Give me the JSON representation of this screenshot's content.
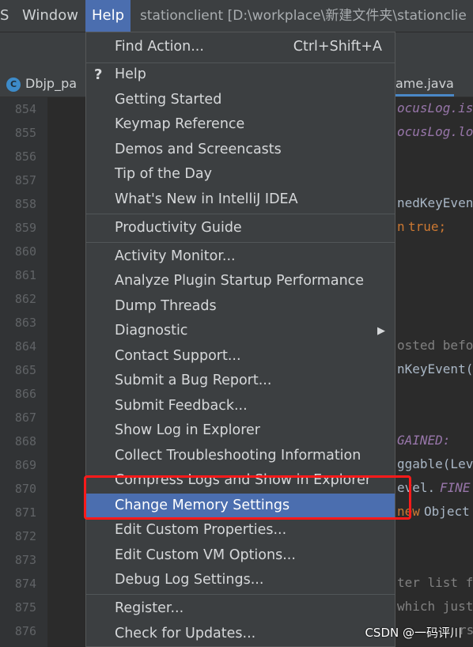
{
  "menubar": {
    "items": [
      "S",
      "Window",
      "Help"
    ],
    "title": "stationclient [D:\\workplace\\新建文件夹\\stationclie"
  },
  "tabs": {
    "left_icon": "C",
    "left_label": "Dbjp_pa",
    "right_label": "ame.java"
  },
  "gutter": {
    "lines": [
      "854",
      "855",
      "856",
      "857",
      "858",
      "859",
      "860",
      "861",
      "862",
      "863",
      "864",
      "865",
      "866",
      "867",
      "868",
      "869",
      "870",
      "871",
      "872",
      "873",
      "874",
      "875",
      "876"
    ]
  },
  "code": {
    "l854": "ocusLog.is",
    "l855": "ocusLog.lo",
    "l858": "nedKeyEven",
    "l859a": "n",
    "l859b": "true;",
    "l864": "osted befo",
    "l865": "nKeyEvent(",
    "l868": "GAINED:",
    "l869": "ggable(Lev",
    "l870a": "evel.",
    "l870b": "FINE",
    "l871a": "new",
    "l871b": "Object",
    "l874": "ter list f",
    "l875": "which just",
    "l876": "rs"
  },
  "menu": {
    "find_action": {
      "label": "Find Action...",
      "shortcut": "Ctrl+Shift+A"
    },
    "help_icon": "?",
    "group1": [
      "Help",
      "Getting Started",
      "Keymap Reference",
      "Demos and Screencasts",
      "Tip of the Day",
      "What's New in IntelliJ IDEA"
    ],
    "productivity": "Productivity Guide",
    "group2": [
      "Activity Monitor...",
      "Analyze Plugin Startup Performance",
      "Dump Threads",
      "Diagnostic",
      "Contact Support...",
      "Submit a Bug Report...",
      "Submit Feedback...",
      "Show Log in Explorer",
      "Collect Troubleshooting Information",
      "Compress Logs and Show in Explorer"
    ],
    "selected": "Change Memory Settings",
    "group3": [
      "Edit Custom Properties...",
      "Edit Custom VM Options...",
      "Debug Log Settings..."
    ],
    "group4": [
      "Register...",
      "Check for Updates..."
    ],
    "submenu_arrow": "▶"
  },
  "watermark": "CSDN @一码评川",
  "colors": {
    "selection": "#4b6eaf",
    "highlight_box": "#ff1a1a",
    "menu_bg": "#3c3f41",
    "editor_bg": "#2b2b2b"
  }
}
